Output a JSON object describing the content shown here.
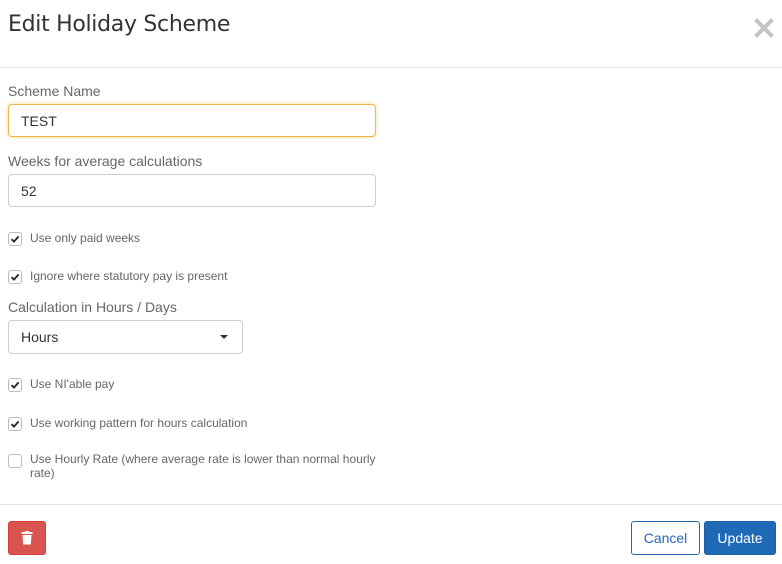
{
  "header": {
    "title": "Edit Holiday Scheme",
    "close_icon": "close-icon"
  },
  "form": {
    "scheme_name": {
      "label": "Scheme Name",
      "value": "TEST"
    },
    "weeks": {
      "label": "Weeks for average calculations",
      "value": "52"
    },
    "use_only_paid_weeks": {
      "label": "Use only paid weeks",
      "checked": true
    },
    "ignore_statutory": {
      "label": "Ignore where statutory pay is present",
      "checked": true
    },
    "calculation_unit": {
      "label": "Calculation in Hours / Days",
      "selected": "Hours"
    },
    "use_niable_pay": {
      "label": "Use NI'able pay",
      "checked": true
    },
    "use_working_pattern": {
      "label": "Use working pattern for hours calculation",
      "checked": true
    },
    "use_hourly_rate": {
      "label": "Use Hourly Rate (where average rate is lower than normal hourly rate)",
      "checked": false
    }
  },
  "footer": {
    "delete_icon": "trash-icon",
    "cancel_label": "Cancel",
    "update_label": "Update"
  },
  "colors": {
    "primary": "#1f6ab7",
    "danger": "#d9534f",
    "focus": "#f0b64a"
  }
}
